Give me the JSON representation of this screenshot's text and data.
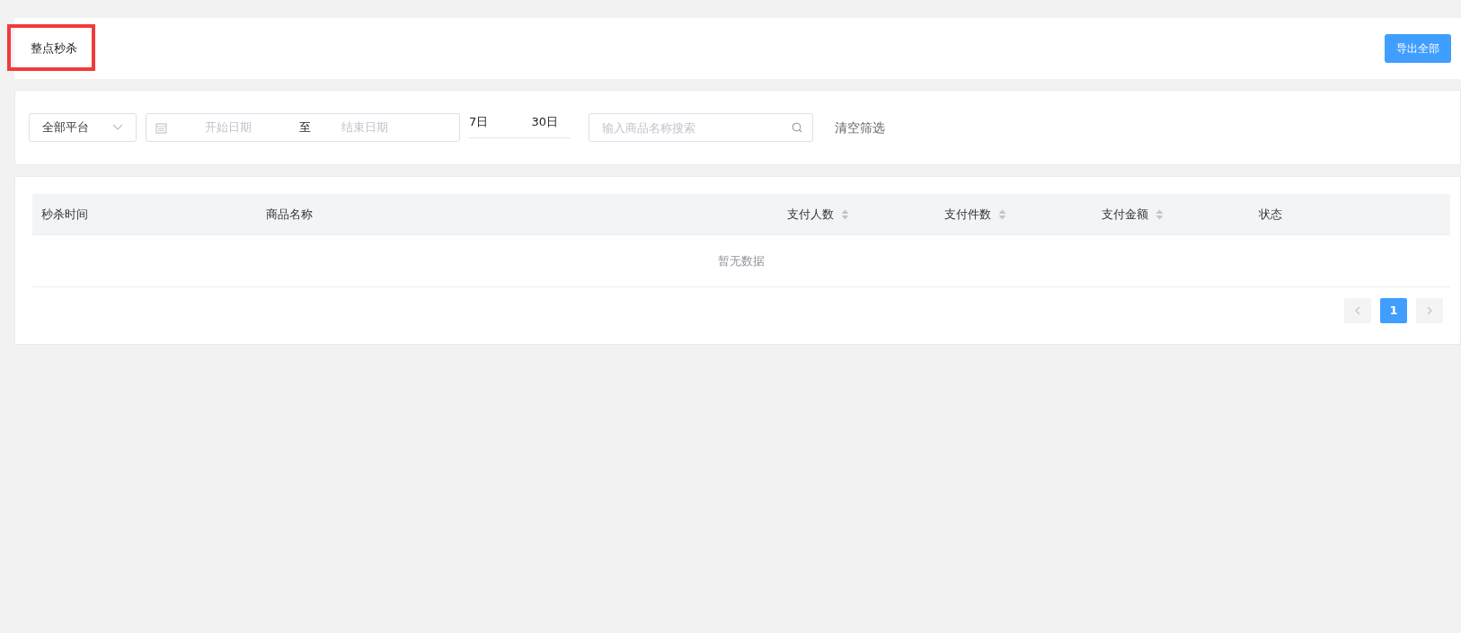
{
  "header": {
    "title": "整点秒杀",
    "export_button": "导出全部"
  },
  "filters": {
    "platform": "全部平台",
    "start_date_placeholder": "开始日期",
    "range_separator": "至",
    "end_date_placeholder": "结束日期",
    "quick_ranges": [
      "7日",
      "30日"
    ],
    "search_placeholder": "输入商品名称搜索",
    "clear": "清空筛选"
  },
  "table": {
    "columns": [
      {
        "label": "秒杀时间",
        "kind": "plain"
      },
      {
        "label": "商品名称",
        "kind": "plain"
      },
      {
        "label": "支付人数",
        "kind": "sortable"
      },
      {
        "label": "支付件数",
        "kind": "sortable"
      },
      {
        "label": "支付金额",
        "kind": "sortable"
      },
      {
        "label": "状态",
        "kind": "plain"
      }
    ],
    "empty_text": "暂无数据"
  },
  "pagination": {
    "pages": [
      {
        "label": "1",
        "selected": true
      }
    ]
  }
}
